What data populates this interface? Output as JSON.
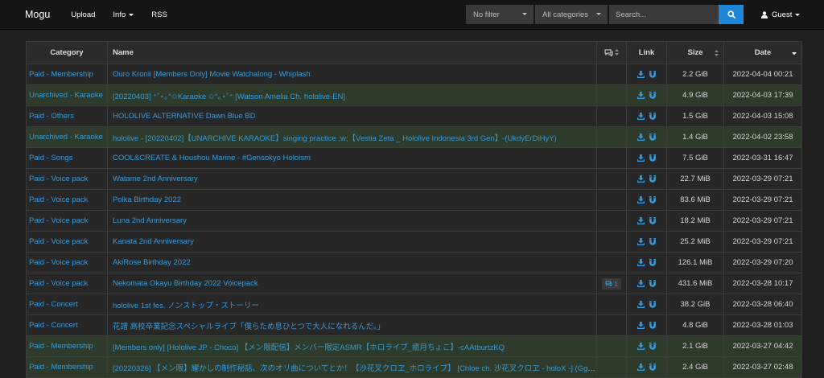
{
  "brand": "Mogu",
  "nav": {
    "upload": "Upload",
    "info": "Info",
    "rss": "RSS"
  },
  "filters": {
    "filter": "No filter",
    "category": "All categories",
    "search_placeholder": "Search..."
  },
  "user": {
    "label": "Guest"
  },
  "colors": {
    "accent": "#1e87d8",
    "link": "#3a9bd8",
    "success_row": "#2e3a2a"
  },
  "table": {
    "headers": {
      "category": "Category",
      "name": "Name",
      "link": "Link",
      "size": "Size",
      "date": "Date"
    },
    "rows": [
      {
        "category": "Paid - Membership",
        "name": "Ouro Kronii [Members Only] Movie Watchalong - Whiplash",
        "size": "2.2 GiB",
        "date": "2022-04-04 00:21",
        "type": "default",
        "comments": ""
      },
      {
        "category": "Unarchived - Karaoke",
        "name": "[20220403] ⁺˚⋆｡°✩Karaoke ✩°｡⋆˚⁺ [Watson Amelia Ch. hololive-EN]",
        "size": "4.9 GiB",
        "date": "2022-04-03 17:39",
        "type": "success",
        "comments": ""
      },
      {
        "category": "Paid - Others",
        "name": "HOLOLIVE ALTERNATIVE Dawn Blue BD",
        "size": "1.5 GiB",
        "date": "2022-04-03 15:08",
        "type": "default",
        "comments": ""
      },
      {
        "category": "Unarchived - Karaoke",
        "name": "hololive - [20220402]【UNARCHIVE KARAOKE】singing practice ;w;【Vestia Zeta _ Hololive Indonesia 3rd Gen】-(UkdyErDiHyY)",
        "size": "1.4 GiB",
        "date": "2022-04-02 23:58",
        "type": "success",
        "comments": ""
      },
      {
        "category": "Paid - Songs",
        "name": "COOL&CREATE & Houshou Marine - #Gensokyo Holoism",
        "size": "7.5 GiB",
        "date": "2022-03-31 16:47",
        "type": "default",
        "comments": ""
      },
      {
        "category": "Paid - Voice pack",
        "name": "Watame 2nd Anniversary",
        "size": "22.7 MiB",
        "date": "2022-03-29 07:21",
        "type": "default",
        "comments": ""
      },
      {
        "category": "Paid - Voice pack",
        "name": "Polka Birthday 2022",
        "size": "83.6 MiB",
        "date": "2022-03-29 07:21",
        "type": "default",
        "comments": ""
      },
      {
        "category": "Paid - Voice pack",
        "name": "Luna 2nd Anniversary",
        "size": "18.2 MiB",
        "date": "2022-03-29 07:21",
        "type": "default",
        "comments": ""
      },
      {
        "category": "Paid - Voice pack",
        "name": "Kanata 2nd Anniversary",
        "size": "25.2 MiB",
        "date": "2022-03-29 07:21",
        "type": "default",
        "comments": ""
      },
      {
        "category": "Paid - Voice pack",
        "name": "AkiRose Birthday 2022",
        "size": "126.1 MiB",
        "date": "2022-03-29 07:20",
        "type": "default",
        "comments": ""
      },
      {
        "category": "Paid - Voice pack",
        "name": "Nekomata Okayu Birthday 2022 Voicepack",
        "size": "431.6 MiB",
        "date": "2022-03-28 10:17",
        "type": "default",
        "comments": "1"
      },
      {
        "category": "Paid - Concert",
        "name": "hololive 1st fes. ノンストップ・ストーリー",
        "size": "38.2 GiB",
        "date": "2022-03-28 06:40",
        "type": "default",
        "comments": ""
      },
      {
        "category": "Paid - Concert",
        "name": "花譜 高校卒業記念スペシャルライブ「僕らため息ひとつで大人になれるんだ。」",
        "size": "4.8 GiB",
        "date": "2022-03-28 01:03",
        "type": "default",
        "comments": ""
      },
      {
        "category": "Paid - Membership",
        "name": "[Members only] [Hololive JP - Choco] 【メン限配信】メンバー限定ASMR【ホロライブ_癒月ちょこ】-cAAtburtzKQ",
        "size": "2.1 GiB",
        "date": "2022-03-27 04:42",
        "type": "success",
        "comments": ""
      },
      {
        "category": "Paid - Membership",
        "name": "[20220326] 【メン限】耀かしの制作秘話、次のオリ曲についてとか！【沙花叉クロヱ_ホロライブ】 [Chloe ch. 沙花叉クロヱ - holoX -] (GgL…",
        "size": "2.4 GiB",
        "date": "2022-03-27 02:48",
        "type": "success",
        "comments": ""
      }
    ]
  }
}
